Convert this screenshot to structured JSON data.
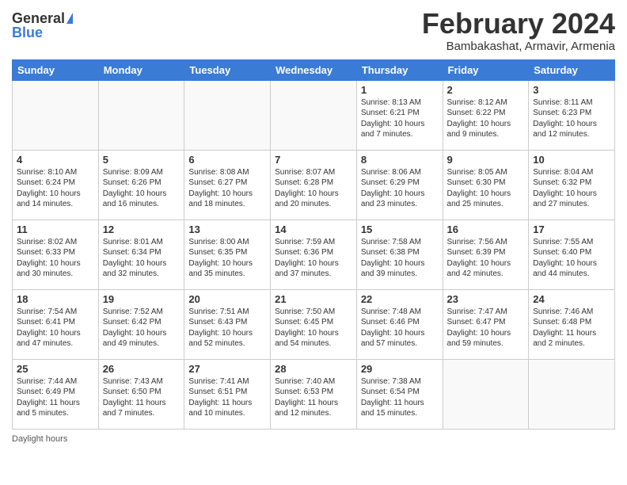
{
  "header": {
    "logo_general": "General",
    "logo_blue": "Blue",
    "month_title": "February 2024",
    "subtitle": "Bambakashat, Armavir, Armenia"
  },
  "days_of_week": [
    "Sunday",
    "Monday",
    "Tuesday",
    "Wednesday",
    "Thursday",
    "Friday",
    "Saturday"
  ],
  "weeks": [
    [
      {
        "day": "",
        "info": ""
      },
      {
        "day": "",
        "info": ""
      },
      {
        "day": "",
        "info": ""
      },
      {
        "day": "",
        "info": ""
      },
      {
        "day": "1",
        "info": "Sunrise: 8:13 AM\nSunset: 6:21 PM\nDaylight: 10 hours and 7 minutes."
      },
      {
        "day": "2",
        "info": "Sunrise: 8:12 AM\nSunset: 6:22 PM\nDaylight: 10 hours and 9 minutes."
      },
      {
        "day": "3",
        "info": "Sunrise: 8:11 AM\nSunset: 6:23 PM\nDaylight: 10 hours and 12 minutes."
      }
    ],
    [
      {
        "day": "4",
        "info": "Sunrise: 8:10 AM\nSunset: 6:24 PM\nDaylight: 10 hours and 14 minutes."
      },
      {
        "day": "5",
        "info": "Sunrise: 8:09 AM\nSunset: 6:26 PM\nDaylight: 10 hours and 16 minutes."
      },
      {
        "day": "6",
        "info": "Sunrise: 8:08 AM\nSunset: 6:27 PM\nDaylight: 10 hours and 18 minutes."
      },
      {
        "day": "7",
        "info": "Sunrise: 8:07 AM\nSunset: 6:28 PM\nDaylight: 10 hours and 20 minutes."
      },
      {
        "day": "8",
        "info": "Sunrise: 8:06 AM\nSunset: 6:29 PM\nDaylight: 10 hours and 23 minutes."
      },
      {
        "day": "9",
        "info": "Sunrise: 8:05 AM\nSunset: 6:30 PM\nDaylight: 10 hours and 25 minutes."
      },
      {
        "day": "10",
        "info": "Sunrise: 8:04 AM\nSunset: 6:32 PM\nDaylight: 10 hours and 27 minutes."
      }
    ],
    [
      {
        "day": "11",
        "info": "Sunrise: 8:02 AM\nSunset: 6:33 PM\nDaylight: 10 hours and 30 minutes."
      },
      {
        "day": "12",
        "info": "Sunrise: 8:01 AM\nSunset: 6:34 PM\nDaylight: 10 hours and 32 minutes."
      },
      {
        "day": "13",
        "info": "Sunrise: 8:00 AM\nSunset: 6:35 PM\nDaylight: 10 hours and 35 minutes."
      },
      {
        "day": "14",
        "info": "Sunrise: 7:59 AM\nSunset: 6:36 PM\nDaylight: 10 hours and 37 minutes."
      },
      {
        "day": "15",
        "info": "Sunrise: 7:58 AM\nSunset: 6:38 PM\nDaylight: 10 hours and 39 minutes."
      },
      {
        "day": "16",
        "info": "Sunrise: 7:56 AM\nSunset: 6:39 PM\nDaylight: 10 hours and 42 minutes."
      },
      {
        "day": "17",
        "info": "Sunrise: 7:55 AM\nSunset: 6:40 PM\nDaylight: 10 hours and 44 minutes."
      }
    ],
    [
      {
        "day": "18",
        "info": "Sunrise: 7:54 AM\nSunset: 6:41 PM\nDaylight: 10 hours and 47 minutes."
      },
      {
        "day": "19",
        "info": "Sunrise: 7:52 AM\nSunset: 6:42 PM\nDaylight: 10 hours and 49 minutes."
      },
      {
        "day": "20",
        "info": "Sunrise: 7:51 AM\nSunset: 6:43 PM\nDaylight: 10 hours and 52 minutes."
      },
      {
        "day": "21",
        "info": "Sunrise: 7:50 AM\nSunset: 6:45 PM\nDaylight: 10 hours and 54 minutes."
      },
      {
        "day": "22",
        "info": "Sunrise: 7:48 AM\nSunset: 6:46 PM\nDaylight: 10 hours and 57 minutes."
      },
      {
        "day": "23",
        "info": "Sunrise: 7:47 AM\nSunset: 6:47 PM\nDaylight: 10 hours and 59 minutes."
      },
      {
        "day": "24",
        "info": "Sunrise: 7:46 AM\nSunset: 6:48 PM\nDaylight: 11 hours and 2 minutes."
      }
    ],
    [
      {
        "day": "25",
        "info": "Sunrise: 7:44 AM\nSunset: 6:49 PM\nDaylight: 11 hours and 5 minutes."
      },
      {
        "day": "26",
        "info": "Sunrise: 7:43 AM\nSunset: 6:50 PM\nDaylight: 11 hours and 7 minutes."
      },
      {
        "day": "27",
        "info": "Sunrise: 7:41 AM\nSunset: 6:51 PM\nDaylight: 11 hours and 10 minutes."
      },
      {
        "day": "28",
        "info": "Sunrise: 7:40 AM\nSunset: 6:53 PM\nDaylight: 11 hours and 12 minutes."
      },
      {
        "day": "29",
        "info": "Sunrise: 7:38 AM\nSunset: 6:54 PM\nDaylight: 11 hours and 15 minutes."
      },
      {
        "day": "",
        "info": ""
      },
      {
        "day": "",
        "info": ""
      }
    ]
  ],
  "footer": {
    "daylight_label": "Daylight hours"
  }
}
